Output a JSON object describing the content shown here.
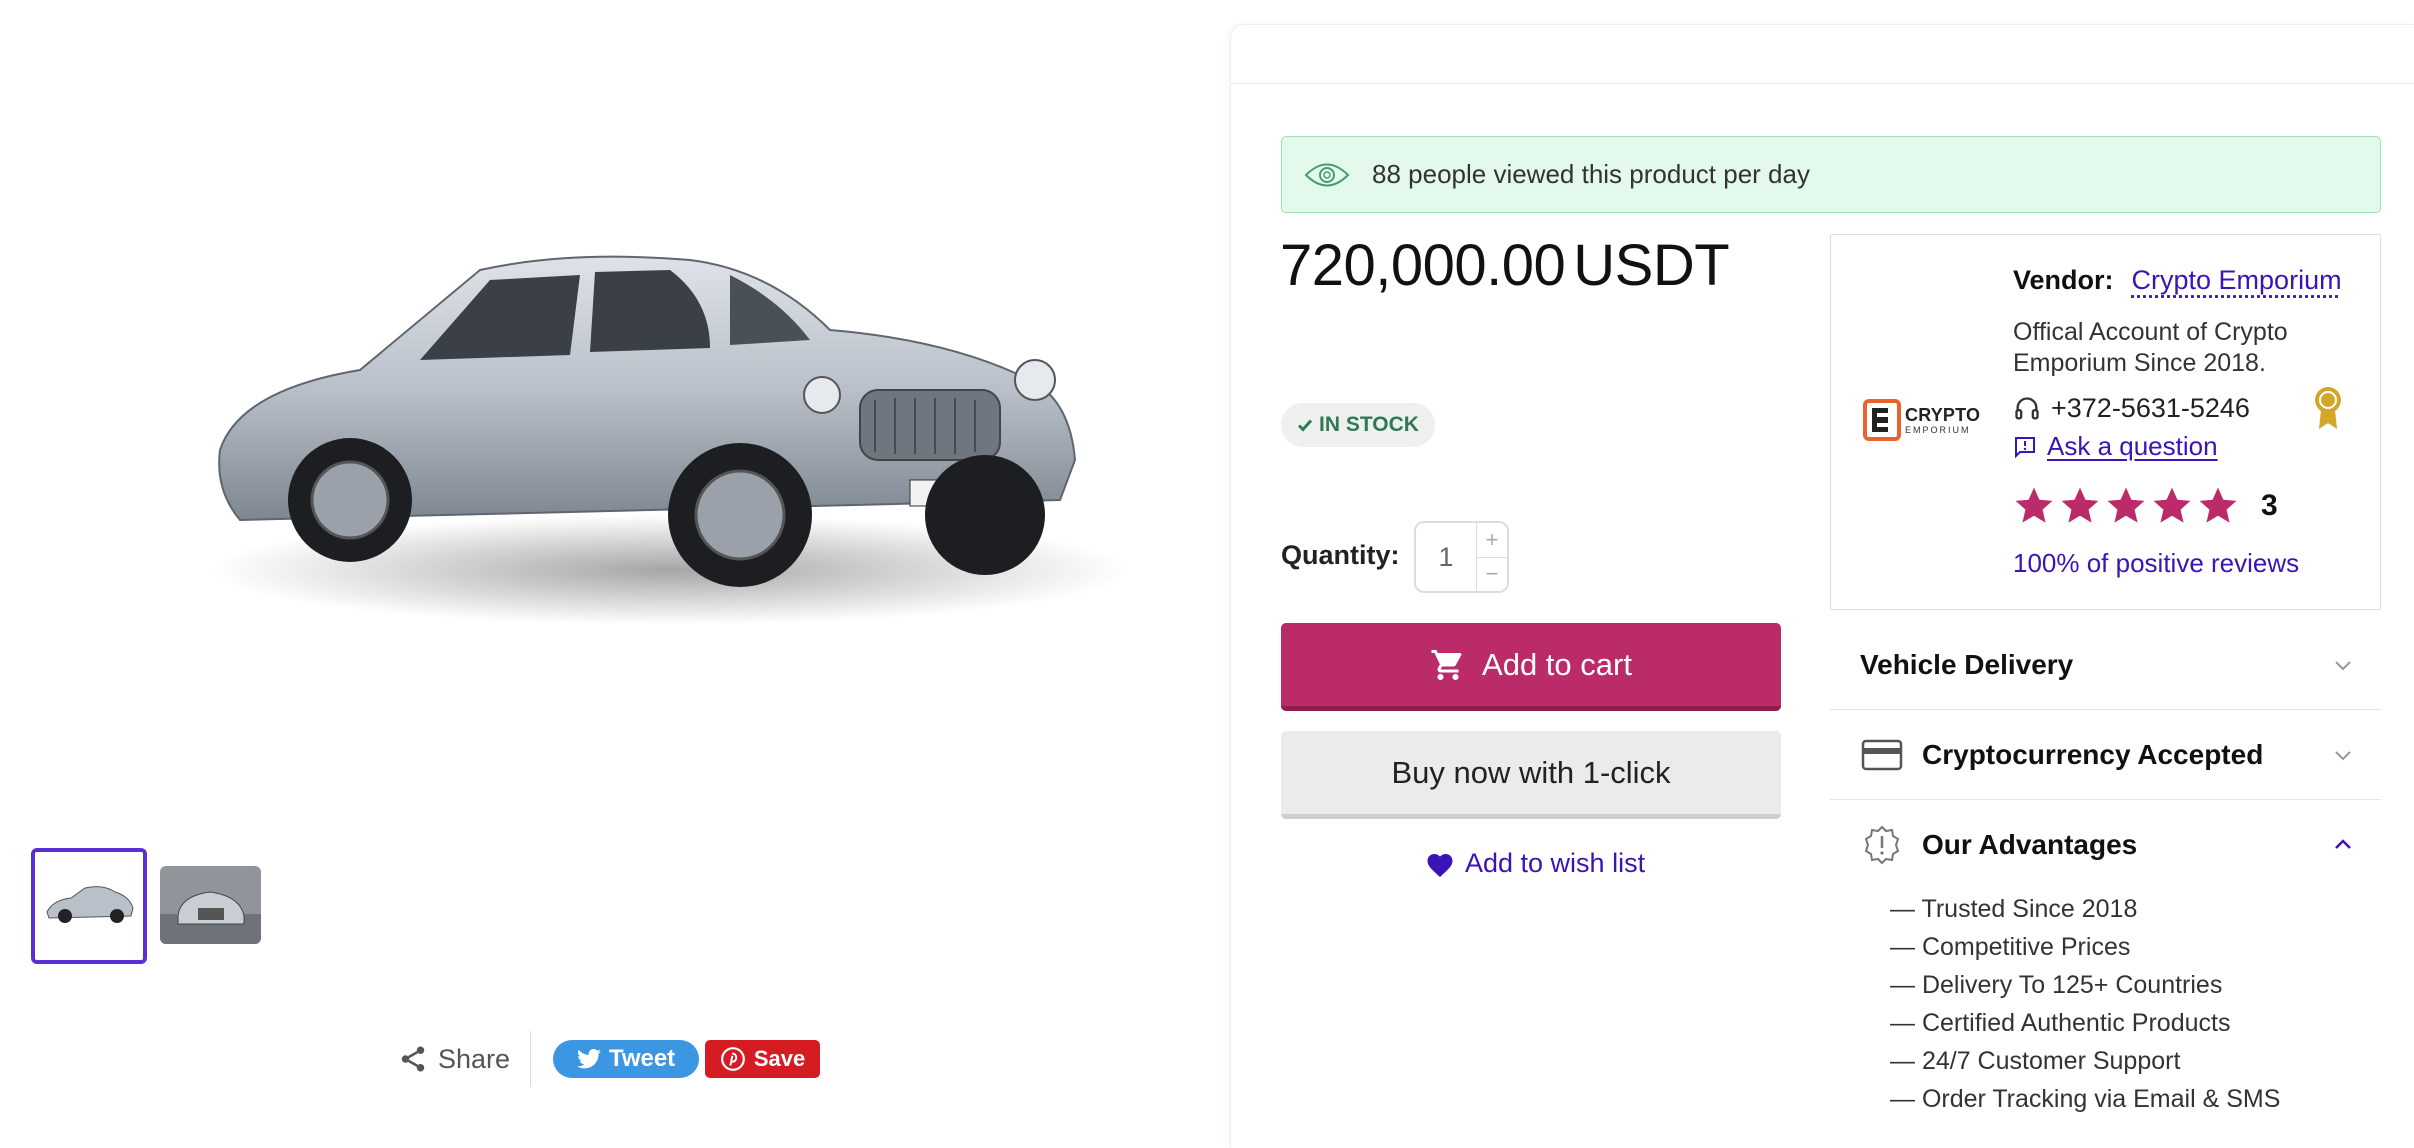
{
  "gallery": {
    "thumbnails": [
      "Side view",
      "Front view"
    ]
  },
  "share": {
    "share_label": "Share",
    "tweet_label": "Tweet",
    "save_label": "Save"
  },
  "viewers_text": "88 people viewed this product per day",
  "price": {
    "amount": "720,000.00",
    "currency": "USDT"
  },
  "stock_label": "IN STOCK",
  "quantity": {
    "label": "Quantity:",
    "value": "1"
  },
  "buttons": {
    "add_to_cart": "Add to cart",
    "buy_now": "Buy now with 1-click",
    "wishlist": "Add to wish list"
  },
  "vendor": {
    "label": "Vendor:",
    "name": "Crypto Emporium",
    "description": "Offical Account of Crypto Emporium Since 2018.",
    "phone": "+372-5631-5246",
    "ask": "Ask a question",
    "rating": 5,
    "review_count": "3",
    "positive_reviews": "100% of positive reviews",
    "logo_line1": "CRYPTO",
    "logo_line2": "EMPORIUM"
  },
  "accordions": {
    "delivery": "Vehicle Delivery",
    "crypto": "Cryptocurrency Accepted",
    "advantages": "Our Advantages"
  },
  "advantages": [
    "— Trusted Since 2018",
    "— Competitive Prices",
    "— Delivery To 125+ Countries",
    "— Certified Authentic Products",
    "— 24/7 Customer Support",
    "— Order Tracking via Email & SMS"
  ],
  "colors": {
    "primary": "#bb2a69",
    "link": "#3b14b8",
    "star": "#bb2a69",
    "viewers_bg": "#e2f9ec",
    "stock_text": "#2f7a55"
  }
}
